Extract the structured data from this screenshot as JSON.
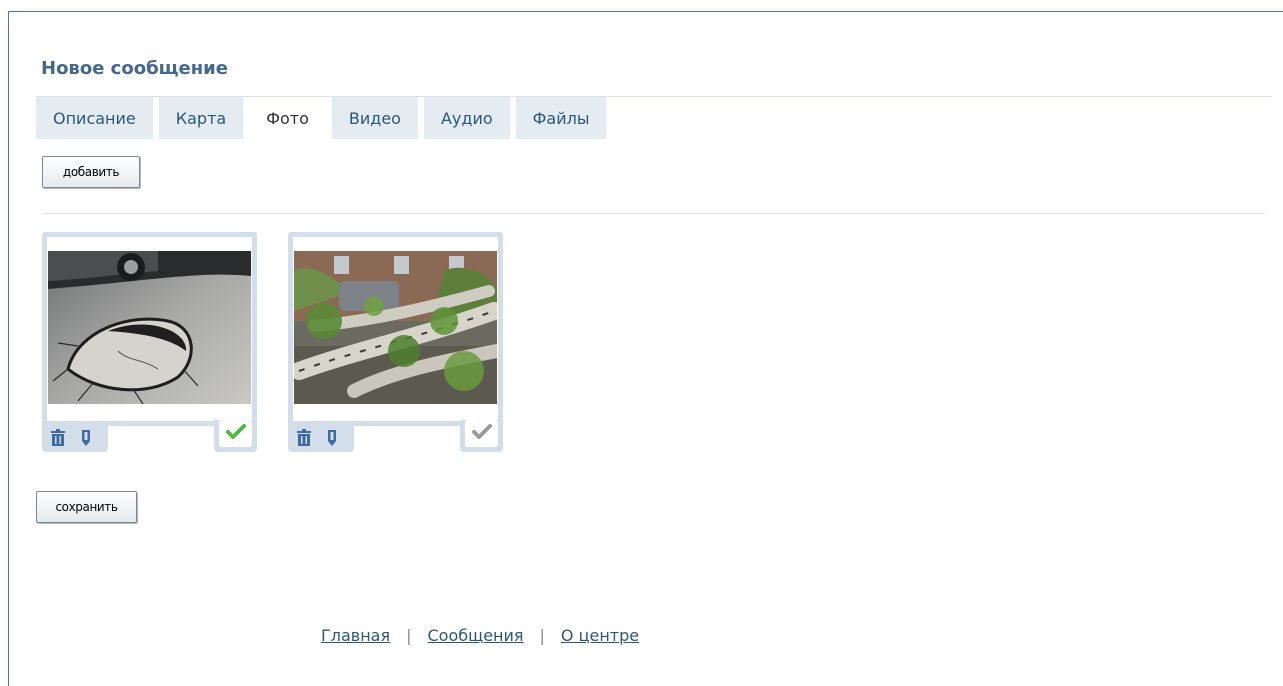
{
  "page": {
    "title": "Новое сообщение"
  },
  "tabs": [
    {
      "label": "Описание",
      "active": false
    },
    {
      "label": "Карта",
      "active": false
    },
    {
      "label": "Фото",
      "active": true
    },
    {
      "label": "Видео",
      "active": false
    },
    {
      "label": "Аудио",
      "active": false
    },
    {
      "label": "Файлы",
      "active": false
    }
  ],
  "photos_panel": {
    "add_label": "добавить",
    "photos": [
      {
        "subject": "asphalt-sinkhole",
        "selected": true
      },
      {
        "subject": "fallen-birch-tree",
        "selected": false
      }
    ]
  },
  "actions": {
    "save_label": "сохранить"
  },
  "footer": {
    "links": [
      "Главная",
      "Сообщения",
      "О центре"
    ],
    "separator": "|"
  },
  "colors": {
    "frame_border": "#4a74b7",
    "title": "#45688e",
    "tab_bg": "#e4ebf1",
    "tab_text": "#2b587a",
    "photo_frame": "#d3deea",
    "icon_blue": "#3f6aa8",
    "check_green": "#52b848",
    "check_gray": "#9a9a9a",
    "link": "#2b587a"
  },
  "icons": [
    "trash-icon",
    "pin-icon",
    "check-icon"
  ]
}
